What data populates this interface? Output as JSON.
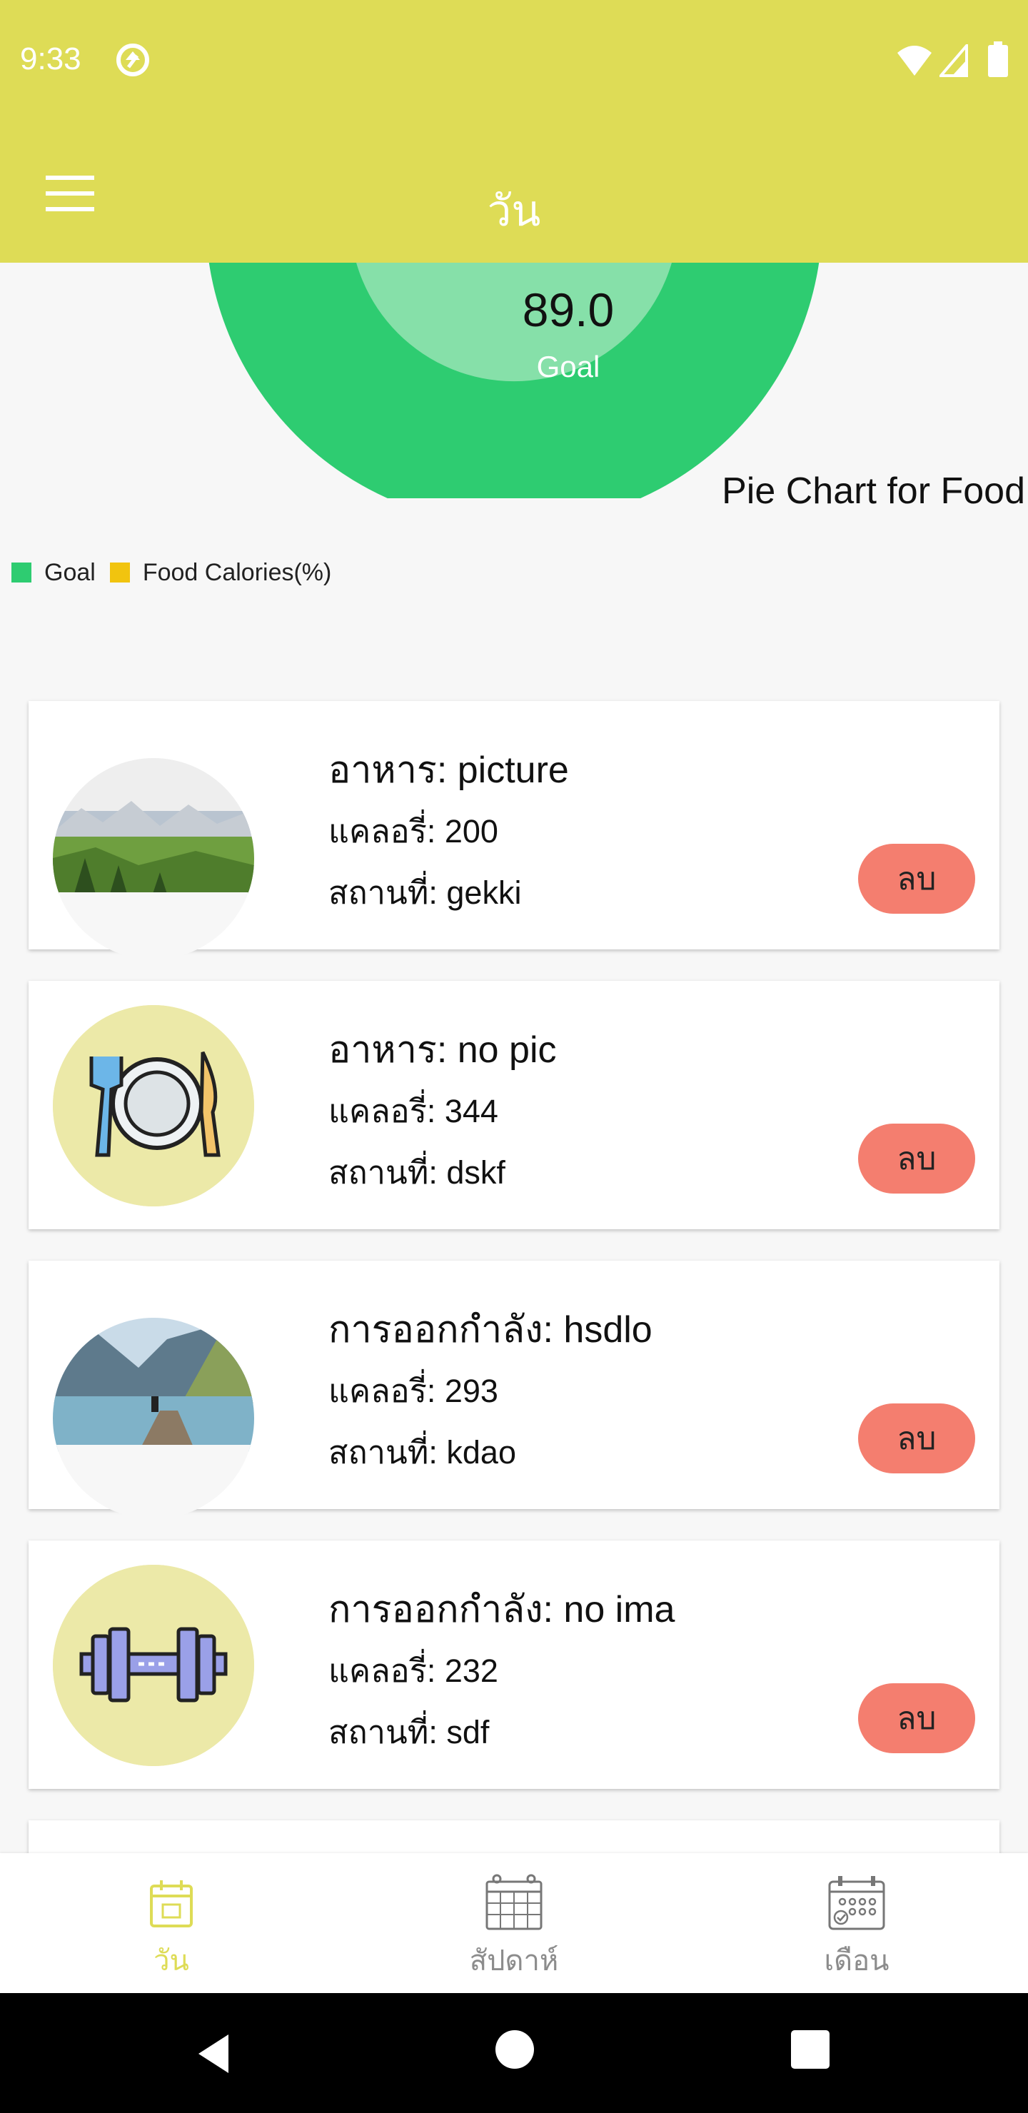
{
  "status_bar": {
    "time": "9:33",
    "icons": [
      "sync-icon",
      "wifi-icon",
      "signal-icon",
      "battery-icon"
    ]
  },
  "app_bar": {
    "title": "วัน",
    "menu_icon": "menu-icon"
  },
  "chart_data": {
    "type": "pie",
    "center_value": "89.0",
    "center_label": "Goal",
    "description": "Pie Chart for Food",
    "slices": [
      {
        "name": "Goal",
        "value": 100,
        "color": "#2ecc71"
      },
      {
        "name": "Food  Calories(%)",
        "value": 0,
        "color": "#f1c40f"
      }
    ],
    "legend": [
      "Goal",
      "Food  Calories(%)"
    ],
    "legend_position": "bottom-left"
  },
  "items": [
    {
      "title": "อาหาร: picture",
      "calories": "แคลอรี่:  200",
      "location": "สถานที่:  gekki",
      "image": "landscape-photo",
      "delete_label": "ลบ"
    },
    {
      "title": "อาหาร: no pic",
      "calories": "แคลอรี่:  344",
      "location": "สถานที่:  dskf",
      "image": "plate-cutlery-icon",
      "delete_label": "ลบ"
    },
    {
      "title": "การออกกำลัง: hsdlo",
      "calories": "แคลอรี่:  293",
      "location": "สถานที่:  kdao",
      "image": "lake-photo",
      "delete_label": "ลบ"
    },
    {
      "title": "การออกกำลัง: no ima",
      "calories": "แคลอรี่:  232",
      "location": "สถานที่:  sdf",
      "image": "dumbbell-icon",
      "delete_label": "ลบ"
    }
  ],
  "bottom_nav": [
    {
      "label": "วัน",
      "icon": "calendar-day-icon",
      "active": true
    },
    {
      "label": "สัปดาห์",
      "icon": "calendar-week-icon",
      "active": false
    },
    {
      "label": "เดือน",
      "icon": "calendar-month-icon",
      "active": false
    }
  ],
  "colors": {
    "app_bar": "#dedc56",
    "goal": "#2ecc71",
    "food": "#f1c40f",
    "delete_button": "#f47e6f",
    "nav_active": "#dedc56"
  }
}
